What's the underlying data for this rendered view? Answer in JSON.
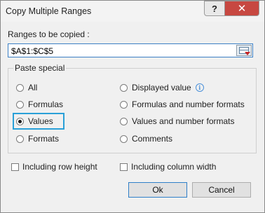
{
  "window": {
    "title": "Copy Multiple Ranges",
    "help_symbol": "?",
    "close_symbol": "✕"
  },
  "range": {
    "label": "Ranges to be copied :",
    "value": "$A$1:$C$5"
  },
  "paste_special": {
    "legend": "Paste special",
    "selected": "Values",
    "options": [
      "All",
      "Formulas",
      "Values",
      "Formats",
      "Displayed value",
      "Formulas and number formats",
      "Values and number formats",
      "Comments"
    ],
    "info_symbol": "i"
  },
  "checkboxes": {
    "row_height": "Including row height",
    "column_width": "Including column width"
  },
  "buttons": {
    "ok": "Ok",
    "cancel": "Cancel"
  }
}
